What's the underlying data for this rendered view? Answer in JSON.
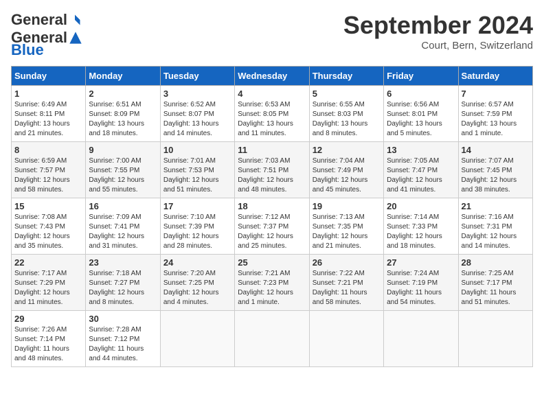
{
  "header": {
    "logo_general": "General",
    "logo_blue": "Blue",
    "month_year": "September 2024",
    "location": "Court, Bern, Switzerland"
  },
  "weekdays": [
    "Sunday",
    "Monday",
    "Tuesday",
    "Wednesday",
    "Thursday",
    "Friday",
    "Saturday"
  ],
  "weeks": [
    [
      {
        "day": "1",
        "info": "Sunrise: 6:49 AM\nSunset: 8:11 PM\nDaylight: 13 hours\nand 21 minutes."
      },
      {
        "day": "2",
        "info": "Sunrise: 6:51 AM\nSunset: 8:09 PM\nDaylight: 13 hours\nand 18 minutes."
      },
      {
        "day": "3",
        "info": "Sunrise: 6:52 AM\nSunset: 8:07 PM\nDaylight: 13 hours\nand 14 minutes."
      },
      {
        "day": "4",
        "info": "Sunrise: 6:53 AM\nSunset: 8:05 PM\nDaylight: 13 hours\nand 11 minutes."
      },
      {
        "day": "5",
        "info": "Sunrise: 6:55 AM\nSunset: 8:03 PM\nDaylight: 13 hours\nand 8 minutes."
      },
      {
        "day": "6",
        "info": "Sunrise: 6:56 AM\nSunset: 8:01 PM\nDaylight: 13 hours\nand 5 minutes."
      },
      {
        "day": "7",
        "info": "Sunrise: 6:57 AM\nSunset: 7:59 PM\nDaylight: 13 hours\nand 1 minute."
      }
    ],
    [
      {
        "day": "8",
        "info": "Sunrise: 6:59 AM\nSunset: 7:57 PM\nDaylight: 12 hours\nand 58 minutes."
      },
      {
        "day": "9",
        "info": "Sunrise: 7:00 AM\nSunset: 7:55 PM\nDaylight: 12 hours\nand 55 minutes."
      },
      {
        "day": "10",
        "info": "Sunrise: 7:01 AM\nSunset: 7:53 PM\nDaylight: 12 hours\nand 51 minutes."
      },
      {
        "day": "11",
        "info": "Sunrise: 7:03 AM\nSunset: 7:51 PM\nDaylight: 12 hours\nand 48 minutes."
      },
      {
        "day": "12",
        "info": "Sunrise: 7:04 AM\nSunset: 7:49 PM\nDaylight: 12 hours\nand 45 minutes."
      },
      {
        "day": "13",
        "info": "Sunrise: 7:05 AM\nSunset: 7:47 PM\nDaylight: 12 hours\nand 41 minutes."
      },
      {
        "day": "14",
        "info": "Sunrise: 7:07 AM\nSunset: 7:45 PM\nDaylight: 12 hours\nand 38 minutes."
      }
    ],
    [
      {
        "day": "15",
        "info": "Sunrise: 7:08 AM\nSunset: 7:43 PM\nDaylight: 12 hours\nand 35 minutes."
      },
      {
        "day": "16",
        "info": "Sunrise: 7:09 AM\nSunset: 7:41 PM\nDaylight: 12 hours\nand 31 minutes."
      },
      {
        "day": "17",
        "info": "Sunrise: 7:10 AM\nSunset: 7:39 PM\nDaylight: 12 hours\nand 28 minutes."
      },
      {
        "day": "18",
        "info": "Sunrise: 7:12 AM\nSunset: 7:37 PM\nDaylight: 12 hours\nand 25 minutes."
      },
      {
        "day": "19",
        "info": "Sunrise: 7:13 AM\nSunset: 7:35 PM\nDaylight: 12 hours\nand 21 minutes."
      },
      {
        "day": "20",
        "info": "Sunrise: 7:14 AM\nSunset: 7:33 PM\nDaylight: 12 hours\nand 18 minutes."
      },
      {
        "day": "21",
        "info": "Sunrise: 7:16 AM\nSunset: 7:31 PM\nDaylight: 12 hours\nand 14 minutes."
      }
    ],
    [
      {
        "day": "22",
        "info": "Sunrise: 7:17 AM\nSunset: 7:29 PM\nDaylight: 12 hours\nand 11 minutes."
      },
      {
        "day": "23",
        "info": "Sunrise: 7:18 AM\nSunset: 7:27 PM\nDaylight: 12 hours\nand 8 minutes."
      },
      {
        "day": "24",
        "info": "Sunrise: 7:20 AM\nSunset: 7:25 PM\nDaylight: 12 hours\nand 4 minutes."
      },
      {
        "day": "25",
        "info": "Sunrise: 7:21 AM\nSunset: 7:23 PM\nDaylight: 12 hours\nand 1 minute."
      },
      {
        "day": "26",
        "info": "Sunrise: 7:22 AM\nSunset: 7:21 PM\nDaylight: 11 hours\nand 58 minutes."
      },
      {
        "day": "27",
        "info": "Sunrise: 7:24 AM\nSunset: 7:19 PM\nDaylight: 11 hours\nand 54 minutes."
      },
      {
        "day": "28",
        "info": "Sunrise: 7:25 AM\nSunset: 7:17 PM\nDaylight: 11 hours\nand 51 minutes."
      }
    ],
    [
      {
        "day": "29",
        "info": "Sunrise: 7:26 AM\nSunset: 7:14 PM\nDaylight: 11 hours\nand 48 minutes."
      },
      {
        "day": "30",
        "info": "Sunrise: 7:28 AM\nSunset: 7:12 PM\nDaylight: 11 hours\nand 44 minutes."
      },
      {
        "day": "",
        "info": ""
      },
      {
        "day": "",
        "info": ""
      },
      {
        "day": "",
        "info": ""
      },
      {
        "day": "",
        "info": ""
      },
      {
        "day": "",
        "info": ""
      }
    ]
  ]
}
